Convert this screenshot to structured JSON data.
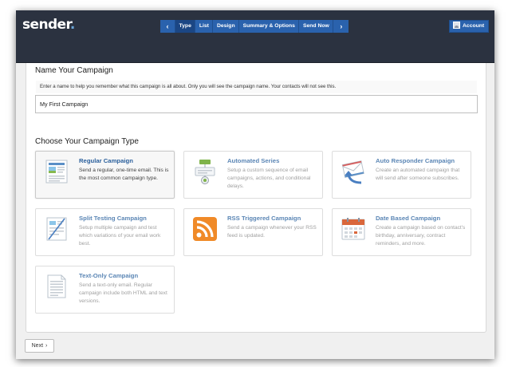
{
  "app": {
    "logo": "sender",
    "logo_dot": "."
  },
  "nav": {
    "prev_arrow": "‹",
    "next_arrow": "›",
    "steps": [
      {
        "label": "Type",
        "active": true
      },
      {
        "label": "List",
        "active": false
      },
      {
        "label": "Design",
        "active": false
      },
      {
        "label": "Summary & Options",
        "active": false
      },
      {
        "label": "Send Now",
        "active": false
      }
    ],
    "account_label": "Account"
  },
  "name_section": {
    "title": "Name Your Campaign",
    "help": "Enter a name to help you remember what this campaign is all about. Only you will see the campaign name. Your contacts will not see this.",
    "input_value": "My First Campaign"
  },
  "type_section": {
    "title": "Choose Your Campaign Type",
    "cards": [
      {
        "title": "Regular Campaign",
        "desc": "Send a regular, one-time email. This is the most common campaign type.",
        "icon": "newsletter-icon",
        "selected": true
      },
      {
        "title": "Automated Series",
        "desc": "Setup a custom sequence of email campaigns, actions, and conditional delays.",
        "icon": "workflow-icon",
        "selected": false
      },
      {
        "title": "Auto Responder Campaign",
        "desc": "Create an automated campaign that will send after someone subscribes.",
        "icon": "envelope-reply-icon",
        "selected": false
      },
      {
        "title": "Split Testing Campaign",
        "desc": "Setup multiple campaign and test which variations of your email work best.",
        "icon": "split-page-icon",
        "selected": false
      },
      {
        "title": "RSS Triggered Campaign",
        "desc": "Send a campaign whenever your RSS feed is updated.",
        "icon": "rss-icon",
        "selected": false
      },
      {
        "title": "Date Based Campaign",
        "desc": "Create a campaign based on contact's birthday, anniversary, contract reminders, and more.",
        "icon": "calendar-icon",
        "selected": false
      },
      {
        "title": "Text-Only Campaign",
        "desc": "Send a text-only email. Regular campaign include both HTML and text versions.",
        "icon": "text-document-icon",
        "selected": false
      }
    ]
  },
  "footer": {
    "next_label": "Next",
    "next_arrow": "›"
  },
  "colors": {
    "topbar": "#2b3240",
    "nav_blue": "#2a62ad",
    "nav_active": "#1b4684",
    "card_title": "#5b86b5",
    "rss_orange": "#f08a28"
  }
}
